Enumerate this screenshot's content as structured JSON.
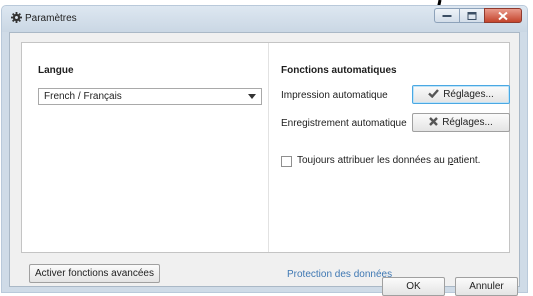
{
  "window": {
    "title": "Paramètres",
    "icons": {
      "app": "gear-icon",
      "minimize": "minimize-icon",
      "maximize": "maximize-icon",
      "close": "close-icon"
    }
  },
  "language": {
    "heading": "Langue",
    "selected": "French / Français",
    "dropdown_icon": "chevron-down-icon"
  },
  "auto_functions": {
    "heading": "Fonctions automatiques",
    "print_label": "Impression automatique",
    "print_button": "Réglages...",
    "print_status_icon": "checkmark-icon",
    "print_status_color": "#555555",
    "save_label": "Enregistrement automatique",
    "save_button": "Réglages...",
    "save_status_icon": "cross-icon",
    "save_status_color": "#555555",
    "always_assign_label_before": "Toujours attribuer les données au ",
    "always_assign_label_accel": "p",
    "always_assign_label_after": "atient.",
    "always_assign_checked": false
  },
  "footer": {
    "advanced_button": "Activer fonctions avancées",
    "data_protection_link": "Protection des données",
    "ok_button": "OK",
    "cancel_button": "Annuler"
  },
  "colors": {
    "link": "#3f78b3",
    "focus_border": "#4aa8e3",
    "close_button": "#c4442c"
  }
}
